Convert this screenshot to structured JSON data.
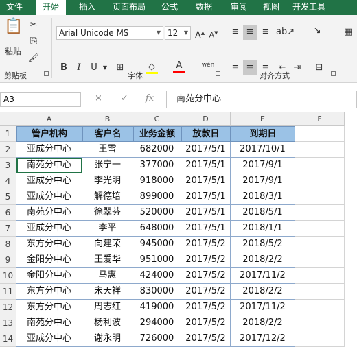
{
  "tabs": [
    "文件",
    "开始",
    "插入",
    "页面布局",
    "公式",
    "数据",
    "审阅",
    "视图",
    "开发工具"
  ],
  "active_tab": "开始",
  "ribbon": {
    "clipboard": {
      "paste_label": "粘贴",
      "group_label": "剪贴板"
    },
    "font": {
      "font_name": "Arial Unicode MS",
      "font_size": "12",
      "group_label": "字体",
      "bold": "B",
      "italic": "I",
      "underline": "U",
      "font_color_glyph": "A",
      "phonetic": "wén"
    },
    "alignment": {
      "group_label": "对齐方式"
    }
  },
  "name_box": "A3",
  "formula_bar": {
    "fx": "fx",
    "cancel": "×",
    "enter": "✓",
    "value": "南苑分中心"
  },
  "columns": [
    "A",
    "B",
    "C",
    "D",
    "E",
    "F"
  ],
  "headers": [
    "管户机构",
    "客户名",
    "业务金额",
    "放款日",
    "到期日"
  ],
  "rows": [
    [
      "亚成分中心",
      "王雪",
      "682000",
      "2017/5/1",
      "2017/10/1"
    ],
    [
      "南苑分中心",
      "张宁一",
      "377000",
      "2017/5/1",
      "2017/9/1"
    ],
    [
      "亚成分中心",
      "李光明",
      "918000",
      "2017/5/1",
      "2017/9/1"
    ],
    [
      "亚成分中心",
      "解德培",
      "899000",
      "2017/5/1",
      "2018/3/1"
    ],
    [
      "南苑分中心",
      "徐翠芬",
      "520000",
      "2017/5/1",
      "2018/5/1"
    ],
    [
      "亚成分中心",
      "李平",
      "648000",
      "2017/5/1",
      "2018/1/1"
    ],
    [
      "东方分中心",
      "向建荣",
      "945000",
      "2017/5/2",
      "2018/5/2"
    ],
    [
      "金阳分中心",
      "王爱华",
      "951000",
      "2017/5/2",
      "2018/2/2"
    ],
    [
      "金阳分中心",
      "马惠",
      "424000",
      "2017/5/2",
      "2017/11/2"
    ],
    [
      "东方分中心",
      "宋天祥",
      "830000",
      "2017/5/2",
      "2018/2/2"
    ],
    [
      "东方分中心",
      "周志红",
      "419000",
      "2017/5/2",
      "2017/11/2"
    ],
    [
      "南苑分中心",
      "杨利波",
      "294000",
      "2017/5/2",
      "2018/2/2"
    ],
    [
      "亚成分中心",
      "谢永明",
      "726000",
      "2017/5/2",
      "2017/12/2"
    ]
  ],
  "row_numbers": [
    "1",
    "2",
    "3",
    "4",
    "5",
    "6",
    "7",
    "8",
    "9",
    "10",
    "11",
    "12",
    "13",
    "14"
  ],
  "selected_cell": "A3"
}
